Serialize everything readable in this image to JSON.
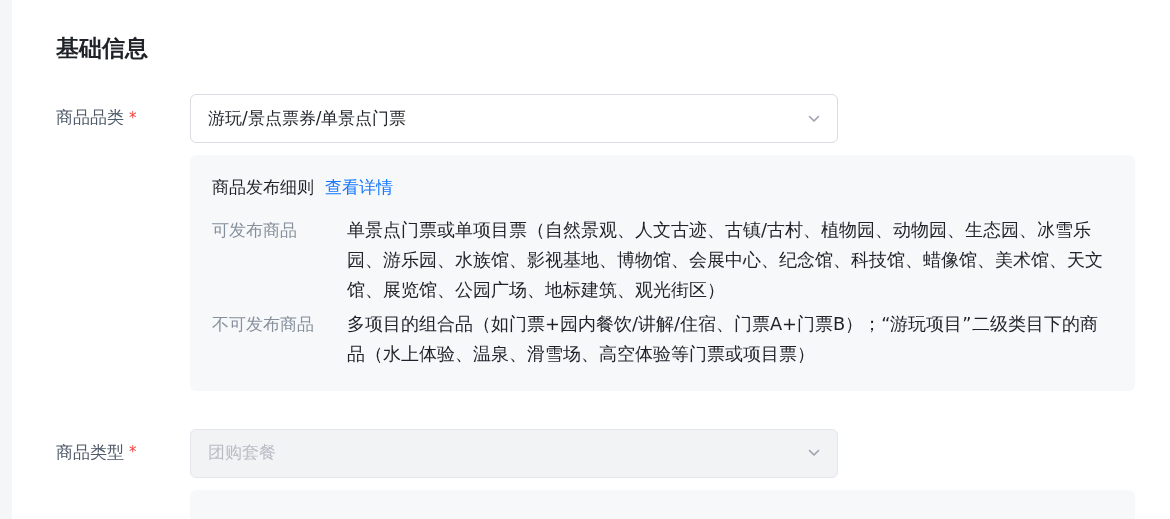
{
  "section_title": "基础信息",
  "fields": [
    {
      "label": "商品品类",
      "required": true,
      "required_mark": "*",
      "value": "游玩/景点票券/单景点门票",
      "disabled": false,
      "rules": {
        "title": "商品发布细则",
        "link": "查看详情",
        "rows": [
          {
            "label": "可发布商品",
            "text": "单景点门票或单项目票（自然景观、人文古迹、古镇/古村、植物园、动物园、生态园、冰雪乐园、游乐园、水族馆、影视基地、博物馆、会展中心、纪念馆、科技馆、蜡像馆、美术馆、天文馆、展览馆、公园广场、地标建筑、观光街区）"
          },
          {
            "label": "不可发布商品",
            "text": "多项目的组合品（如门票+园内餐饮/讲解/住宿、门票A+门票B）；“游玩项目”二级类目下的商品（水上体验、温泉、滑雪场、高空体验等门票或项目票）"
          }
        ]
      }
    },
    {
      "label": "商品类型",
      "required": true,
      "required_mark": "*",
      "value": "团购套餐",
      "disabled": true
    }
  ]
}
